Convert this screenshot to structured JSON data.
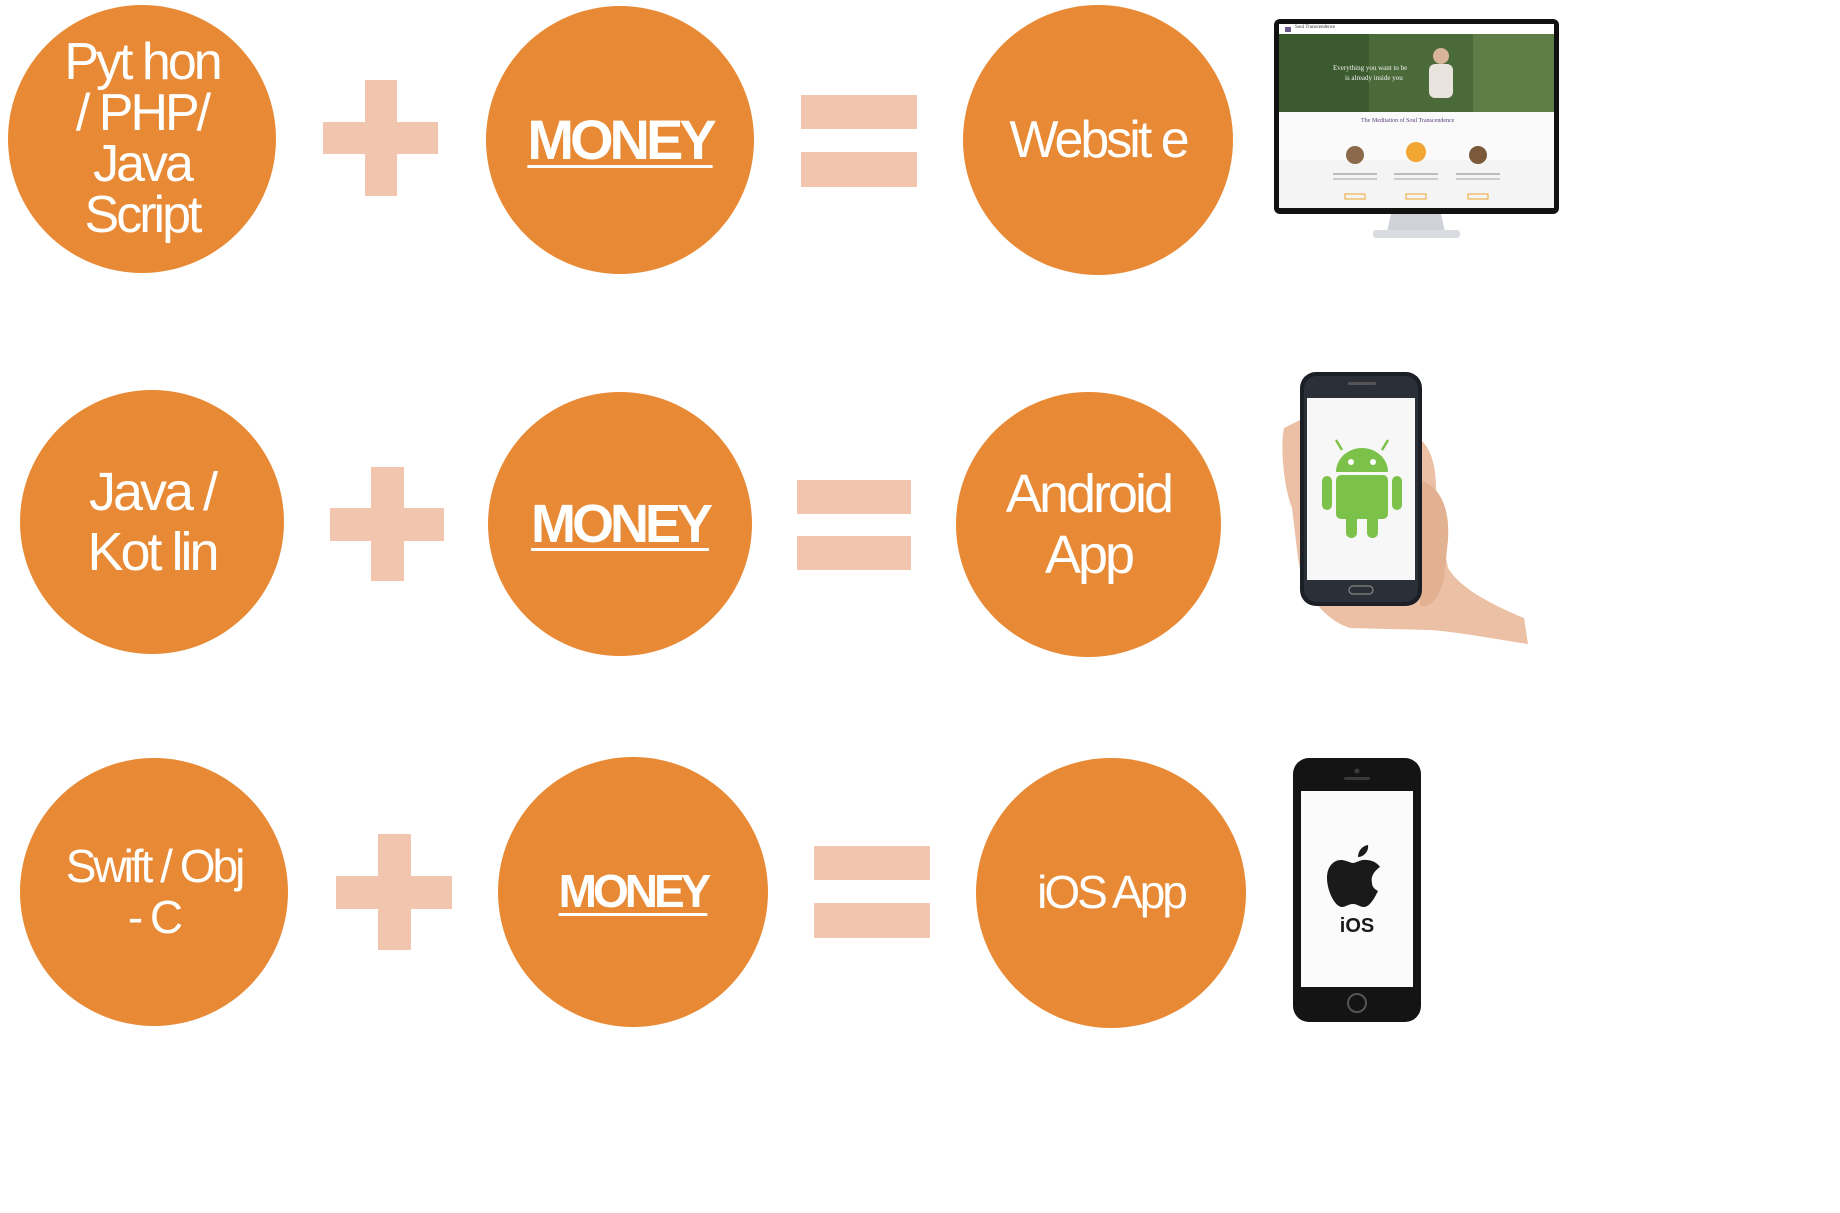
{
  "colors": {
    "circle": "#e88a35",
    "operator": "#f2c5ae",
    "text": "#ffffff"
  },
  "rows": [
    {
      "source": "Pyt hon\n/ PHP/\nJava\nScript",
      "money": "MONEY",
      "result": "Websit e",
      "device": "website-screenshot",
      "screen": {
        "brand": "Soul Transcendence",
        "hero_line1": "Everything you want to be",
        "hero_line2": "is already inside you",
        "section_title": "The Meditation of Soul Transcendence"
      }
    },
    {
      "source": "Java /\nKot lin",
      "money": "MONEY",
      "result": "Android\nApp",
      "device": "android-phone"
    },
    {
      "source": "Swift / Obj\n- C",
      "money": "MONEY",
      "result": "iOS App",
      "device": "iphone",
      "screen": {
        "label": "iOS"
      }
    }
  ]
}
